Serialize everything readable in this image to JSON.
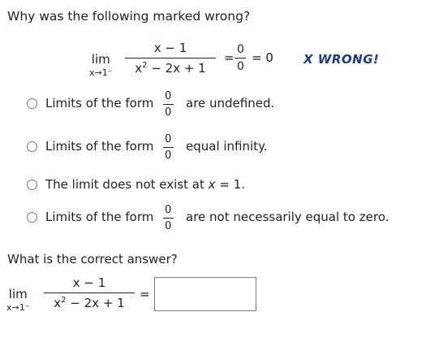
{
  "question": {
    "title": "Why was the following marked wrong?",
    "limit_word": "lim",
    "limit_sub": "x→1⁻",
    "numerator": "x − 1",
    "denominator_base": "x",
    "denominator_exp": "2",
    "denominator_rest": " − 2x + 1",
    "equals1": "=",
    "result_num": "0",
    "result_den": "0",
    "equals2": "= 0",
    "marked_status": "X  WRONG!"
  },
  "options": [
    {
      "pre": "Limits of the form",
      "num": "0",
      "den": "0",
      "post": "are undefined."
    },
    {
      "pre": "Limits of the form",
      "num": "0",
      "den": "0",
      "post": "equal infinity."
    },
    {
      "pre": "The limit does not exist at ",
      "var": "x",
      "post": " = 1."
    },
    {
      "pre": "Limits of the form",
      "num": "0",
      "den": "0",
      "post": "are not necessarily equal to zero."
    }
  ],
  "correct_prompt": "What is the correct answer?",
  "answer": {
    "limit_word": "lim",
    "limit_sub": "x→1⁻",
    "numerator": "x − 1",
    "denominator_base": "x",
    "denominator_exp": "2",
    "denominator_rest": " − 2x + 1",
    "equals": "=",
    "input_value": ""
  },
  "colors": {
    "wrong_text": "#1a3a8a",
    "text": "#222222",
    "border": "#777777"
  }
}
